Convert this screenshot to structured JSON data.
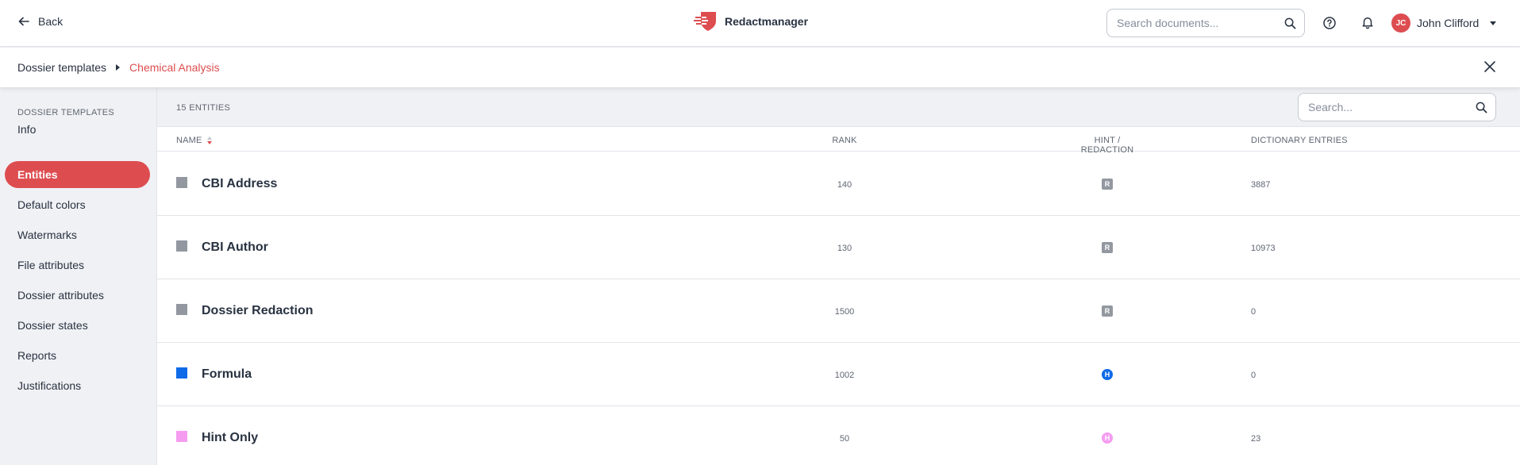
{
  "header": {
    "back_label": "Back",
    "app_name": "Redactmanager",
    "search_placeholder": "Search documents...",
    "user": {
      "initials": "JC",
      "name": "John Clifford"
    },
    "brand_color": "#dd4d50"
  },
  "breadcrumb": {
    "parent": "Dossier templates",
    "current": "Chemical Analysis"
  },
  "sidebar": {
    "title": "DOSSIER TEMPLATES",
    "items": [
      {
        "label": "Info",
        "active": false
      },
      {
        "label": "Entities",
        "active": true
      },
      {
        "label": "Default colors",
        "active": false
      },
      {
        "label": "Watermarks",
        "active": false
      },
      {
        "label": "File attributes",
        "active": false
      },
      {
        "label": "Dossier attributes",
        "active": false
      },
      {
        "label": "Dossier states",
        "active": false
      },
      {
        "label": "Reports",
        "active": false
      },
      {
        "label": "Justifications",
        "active": false
      }
    ]
  },
  "main": {
    "count_label": "15 ENTITIES",
    "search_placeholder": "Search...",
    "columns": {
      "name": "NAME",
      "rank": "RANK",
      "type": "HINT / REDACTION",
      "entries": "DICTIONARY ENTRIES"
    },
    "rows": [
      {
        "name": "CBI Address",
        "rank": "140",
        "badge": "R",
        "kind": "redaction",
        "color": "#9398a0",
        "entries": "3887"
      },
      {
        "name": "CBI Author",
        "rank": "130",
        "badge": "R",
        "kind": "redaction",
        "color": "#9398a0",
        "entries": "10973"
      },
      {
        "name": "Dossier Redaction",
        "rank": "1500",
        "badge": "R",
        "kind": "redaction",
        "color": "#9398a0",
        "entries": "0"
      },
      {
        "name": "Formula",
        "rank": "1002",
        "badge": "H",
        "kind": "hint",
        "color": "#0e6ae8",
        "entries": "0"
      },
      {
        "name": "Hint Only",
        "rank": "50",
        "badge": "H",
        "kind": "hint",
        "color": "#f59cf0",
        "entries": "23"
      }
    ]
  }
}
